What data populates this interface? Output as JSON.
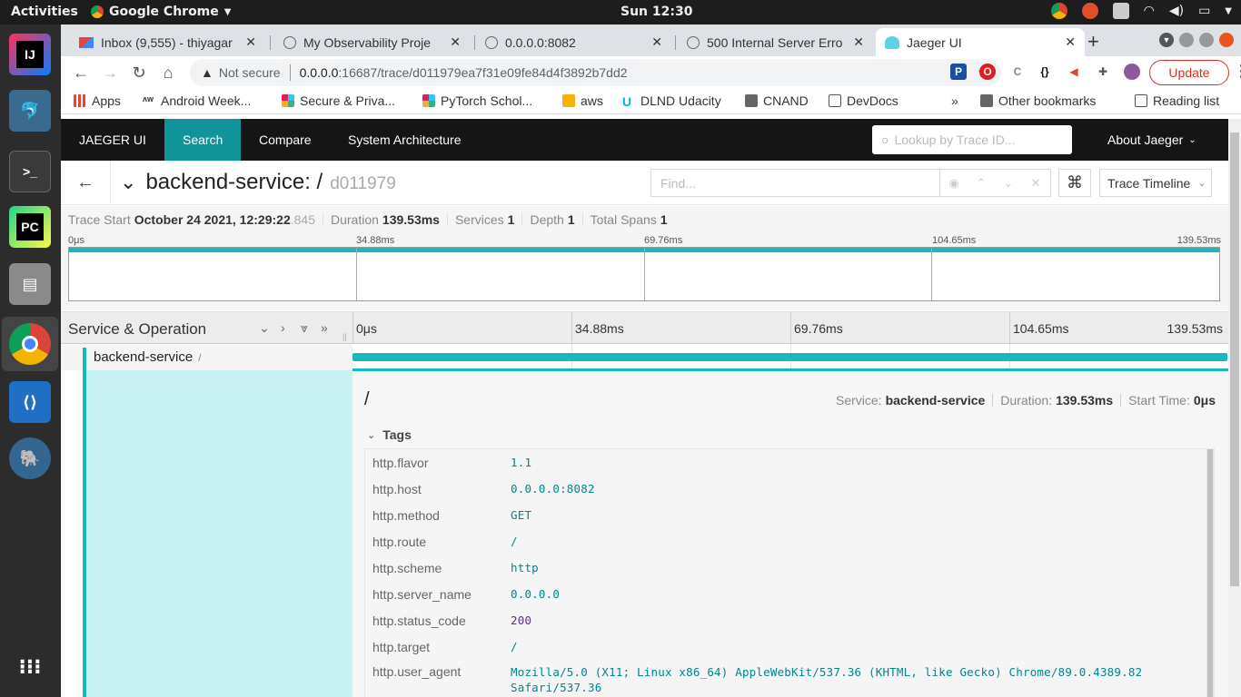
{
  "os": {
    "activities": "Activities",
    "app_name": "Google Chrome",
    "clock": "Sun 12:30"
  },
  "browser": {
    "tabs": [
      {
        "title": "Inbox (9,555) - thiyagar",
        "icon": "gmail-icon"
      },
      {
        "title": "My Observability Proje",
        "icon": "globe-icon"
      },
      {
        "title": "0.0.0.0:8082",
        "icon": "globe-icon"
      },
      {
        "title": "500 Internal Server Erro",
        "icon": "globe-icon"
      },
      {
        "title": "Jaeger UI",
        "icon": "jaeger-icon",
        "active": true
      }
    ],
    "address": {
      "security": "Not secure",
      "host": "0.0.0.0",
      "path": ":16687/trace/d011979ea7f31e09fe84d4f3892b7dd2"
    },
    "update_label": "Update",
    "bookmarks": [
      {
        "label": "Apps"
      },
      {
        "label": "Android Week..."
      },
      {
        "label": "Secure & Priva..."
      },
      {
        "label": "PyTorch Schol..."
      },
      {
        "label": "aws"
      },
      {
        "label": "DLND Udacity"
      },
      {
        "label": "CNAND"
      },
      {
        "label": "DevDocs"
      }
    ],
    "overflow": "»",
    "other_bookmarks": "Other bookmarks",
    "reading_list": "Reading list"
  },
  "jaeger": {
    "nav": {
      "brand": "JAEGER UI",
      "search": "Search",
      "compare": "Compare",
      "architecture": "System Architecture",
      "lookup_placeholder": "Lookup by Trace ID...",
      "about": "About Jaeger"
    },
    "trace": {
      "title": "backend-service: /",
      "id_short": "d011979",
      "find_placeholder": "Find...",
      "view": "Trace Timeline"
    },
    "summary": {
      "start_label": "Trace Start",
      "start_value": "October 24 2021, 12:29:22",
      "start_ms": ".845",
      "duration_label": "Duration",
      "duration_value": "139.53ms",
      "services_label": "Services",
      "services_value": "1",
      "depth_label": "Depth",
      "depth_value": "1",
      "spans_label": "Total Spans",
      "spans_value": "1"
    },
    "ticks": [
      "0μs",
      "34.88ms",
      "69.76ms",
      "104.65ms",
      "139.53ms"
    ],
    "timeline_header": "Service & Operation",
    "span": {
      "service": "backend-service",
      "operation": "/",
      "start_fraction": 0,
      "duration_fraction": 1.0
    },
    "detail": {
      "operation": "/",
      "service_label": "Service:",
      "service_value": "backend-service",
      "duration_label": "Duration:",
      "duration_value": "139.53ms",
      "start_label": "Start Time:",
      "start_value": "0μs",
      "tags_title": "Tags",
      "tags": [
        {
          "key": "http.flavor",
          "value": "1.1"
        },
        {
          "key": "http.host",
          "value": "0.0.0.0:8082"
        },
        {
          "key": "http.method",
          "value": "GET"
        },
        {
          "key": "http.route",
          "value": "/"
        },
        {
          "key": "http.scheme",
          "value": "http"
        },
        {
          "key": "http.server_name",
          "value": "0.0.0.0"
        },
        {
          "key": "http.status_code",
          "value": "200"
        },
        {
          "key": "http.target",
          "value": "/"
        },
        {
          "key": "http.user_agent",
          "value": "Mozilla/5.0 (X11; Linux x86_64) AppleWebKit/537.36 (KHTML, like Gecko) Chrome/89.0.4389.82 Safari/537.36"
        }
      ]
    }
  },
  "colors": {
    "teal": "#17b8be",
    "nav_active": "#11939a",
    "nav_bg": "#151515"
  }
}
